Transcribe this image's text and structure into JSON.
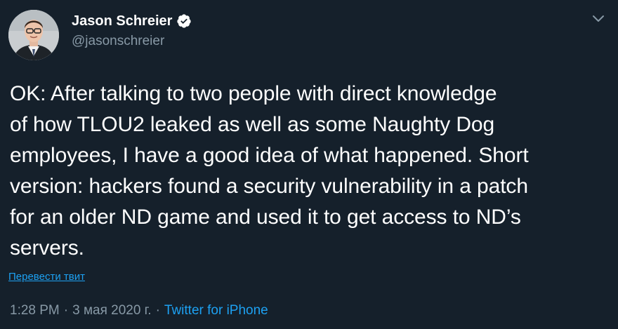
{
  "author": {
    "name": "Jason Schreier",
    "handle": "@jasonschreier",
    "verified": true,
    "avatar_icon": "profile-photo"
  },
  "tweet": {
    "text": "OK: After talking to two people with direct knowledge\nof how TLOU2 leaked as well as some Naughty Dog\nemployees, I have a good idea of what happened. Short\nversion: hackers found a security vulnerability in a patch\nfor an older ND game and used it to get access to ND’s\nservers.",
    "translate_label": "Перевести твит"
  },
  "meta": {
    "time": "1:28 PM",
    "separator": "·",
    "date": "3 мая 2020 г.",
    "source": "Twitter for iPhone"
  },
  "icons": {
    "verified": "verified-badge-icon",
    "more": "chevron-down-icon"
  },
  "colors": {
    "background": "#15202b",
    "text": "#ffffff",
    "secondary": "#8899a6",
    "accent": "#1da1f2"
  }
}
